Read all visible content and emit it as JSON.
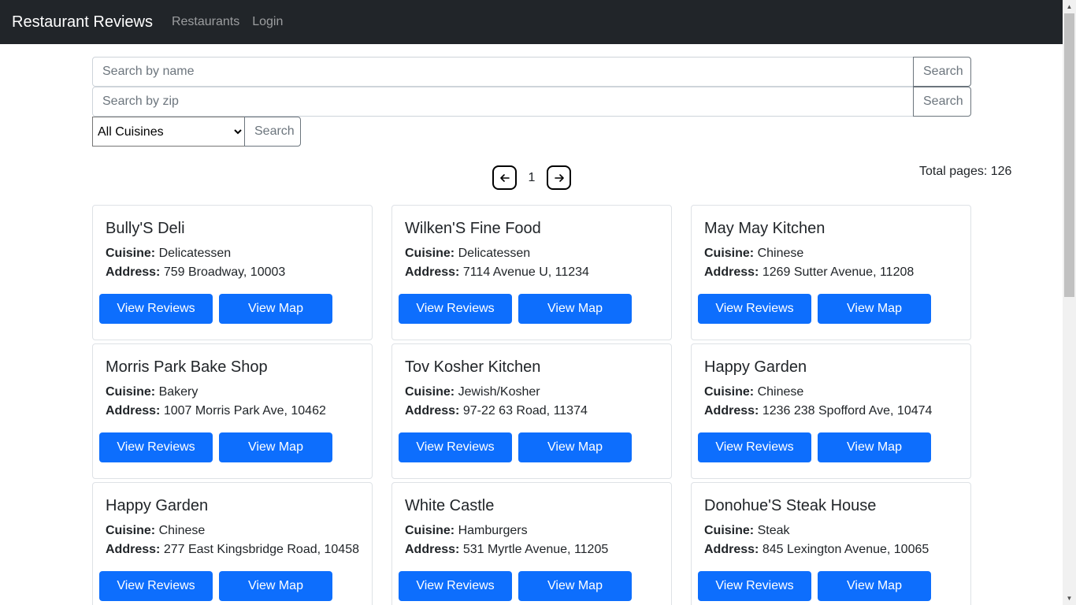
{
  "nav": {
    "brand": "Restaurant Reviews",
    "links": [
      "Restaurants",
      "Login"
    ]
  },
  "search": {
    "name_placeholder": "Search by name",
    "zip_placeholder": "Search by zip",
    "button_label": "Search",
    "cuisine_selected": "All Cuisines"
  },
  "pagination": {
    "current_page": "1",
    "total_pages_text": "Total pages: 126"
  },
  "labels": {
    "cuisine": "Cuisine:",
    "address": "Address:",
    "view_reviews": "View Reviews",
    "view_map": "View Map"
  },
  "restaurants": [
    {
      "name": "Bully'S Deli",
      "cuisine": "Delicatessen",
      "address": "759 Broadway, 10003"
    },
    {
      "name": "Wilken'S Fine Food",
      "cuisine": "Delicatessen",
      "address": "7114 Avenue U, 11234"
    },
    {
      "name": "May May Kitchen",
      "cuisine": "Chinese",
      "address": "1269 Sutter Avenue, 11208"
    },
    {
      "name": "Morris Park Bake Shop",
      "cuisine": "Bakery",
      "address": "1007 Morris Park Ave, 10462"
    },
    {
      "name": "Tov Kosher Kitchen",
      "cuisine": "Jewish/Kosher",
      "address": "97-22 63 Road, 11374"
    },
    {
      "name": "Happy Garden",
      "cuisine": "Chinese",
      "address": "1236 238 Spofford Ave, 10474"
    },
    {
      "name": "Happy Garden",
      "cuisine": "Chinese",
      "address": "277 East Kingsbridge Road, 10458"
    },
    {
      "name": "White Castle",
      "cuisine": "Hamburgers",
      "address": "531 Myrtle Avenue, 11205"
    },
    {
      "name": "Donohue'S Steak House",
      "cuisine": "Steak",
      "address": "845 Lexington Avenue, 10065"
    }
  ],
  "colors": {
    "navbar": "#212529",
    "primary": "#0d6efd"
  }
}
